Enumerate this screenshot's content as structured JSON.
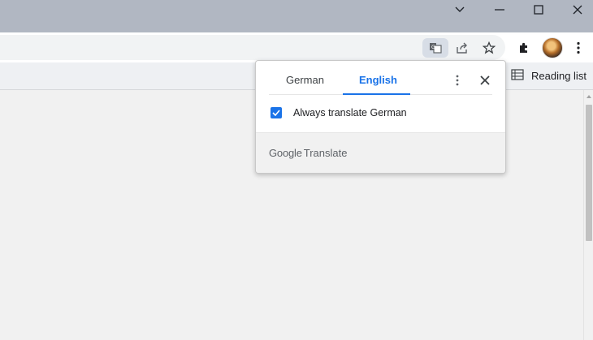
{
  "window_controls": {
    "icons": [
      "chevron-down-icon",
      "minimize-icon",
      "maximize-icon",
      "close-icon"
    ]
  },
  "toolbar": {
    "icons": [
      "translate-icon",
      "share-icon",
      "bookmark-star-icon",
      "extensions-icon",
      "profile-avatar",
      "kebab-menu-icon"
    ]
  },
  "bookmarks_bar": {
    "reading_list_label": "Reading list"
  },
  "translate_popup": {
    "tabs": [
      {
        "label": "German",
        "selected": false
      },
      {
        "label": "English",
        "selected": true
      }
    ],
    "always_translate_label": "Always translate German",
    "always_translate_checked": true,
    "brand_google": "Google",
    "brand_translate": "Translate"
  },
  "colors": {
    "accent": "#1a73e8",
    "titlebar": "#b1b7c2"
  }
}
